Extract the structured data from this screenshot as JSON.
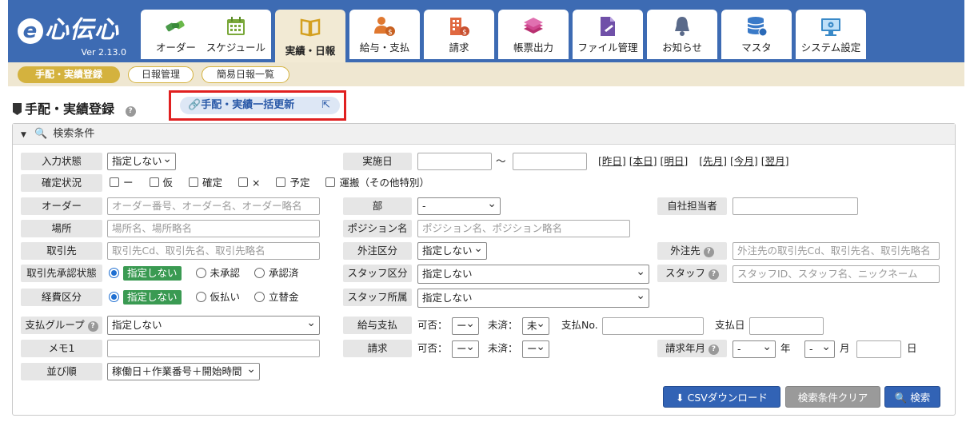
{
  "app": {
    "logo_text": "心伝心",
    "version": "Ver 2.13.0"
  },
  "nav": {
    "tabs": [
      {
        "label": "オーダー",
        "icon": "handshake-icon",
        "color": "#4a9a4a"
      },
      {
        "label": "スケジュール",
        "icon": "calendar-icon",
        "color": "#7aa83a"
      },
      {
        "label": "実績・日報",
        "icon": "book-icon",
        "color": "#d4a020"
      },
      {
        "label": "給与・支払",
        "icon": "person-money-icon",
        "color": "#e07830"
      },
      {
        "label": "請求",
        "icon": "building-money-icon",
        "color": "#e06840"
      },
      {
        "label": "帳票出力",
        "icon": "documents-icon",
        "color": "#d04890"
      },
      {
        "label": "ファイル管理",
        "icon": "file-icon",
        "color": "#7050a8"
      },
      {
        "label": "お知らせ",
        "icon": "bell-icon",
        "color": "#5a6a8a"
      },
      {
        "label": "マスタ",
        "icon": "database-icon",
        "color": "#3a7ac8"
      },
      {
        "label": "システム設定",
        "icon": "monitor-gear-icon",
        "color": "#3a8ac8"
      }
    ]
  },
  "subnav": {
    "items": [
      "手配・実績登録",
      "日報管理",
      "簡易日報一覧"
    ]
  },
  "page": {
    "title": "手配・実績登録",
    "bulk_update_label": "手配・実績一括更新"
  },
  "search": {
    "header": "検索条件",
    "input_status_label": "入力状態",
    "input_status_value": "指定しない",
    "confirm_label": "確定状況",
    "confirm_options": [
      "ー",
      "仮",
      "確定",
      "×",
      "予定",
      "運搬（その他特別）"
    ],
    "order_label": "オーダー",
    "order_placeholder": "オーダー番号、オーダー名、オーダー略名",
    "place_label": "場所",
    "place_placeholder": "場所名、場所略名",
    "client_label": "取引先",
    "client_placeholder": "取引先Cd、取引先名、取引先略名",
    "client_approval_label": "取引先承認状態",
    "client_approval_options": [
      "指定しない",
      "未承認",
      "承認済"
    ],
    "expense_label": "経費区分",
    "expense_options": [
      "指定しない",
      "仮払い",
      "立替金"
    ],
    "pay_group_label": "支払グループ",
    "pay_group_value": "指定しない",
    "memo_label": "メモ1",
    "sort_label": "並び順",
    "sort_value": "稼働日＋作業番号＋開始時間",
    "date_label": "実施日",
    "date_sep": "～",
    "date_links": [
      "[昨日]",
      "[本日]",
      "[明日]",
      "[先月]",
      "[今月]",
      "[翌月]"
    ],
    "dept_label": "部",
    "dept_value": "-",
    "position_label": "ポジション名",
    "position_placeholder": "ポジション名、ポジション略名",
    "outsource_type_label": "外注区分",
    "outsource_type_value": "指定しない",
    "staff_type_label": "スタッフ区分",
    "staff_type_value": "指定しない",
    "staff_dept_label": "スタッフ所属",
    "staff_dept_value": "指定しない",
    "salary_label": "給与支払",
    "salary_possible_label": "可否：",
    "salary_possible_value": "ー",
    "salary_unsettled_label": "未済：",
    "salary_unsettled_value": "未",
    "pay_no_label": "支払No.",
    "pay_date_label": "支払日",
    "billing_label": "請求",
    "billing_possible_label": "可否：",
    "billing_possible_value": "ー",
    "billing_unsettled_label": "未済：",
    "billing_unsettled_value": "ー",
    "manager_label": "自社担当者",
    "outsource_label": "外注先",
    "outsource_placeholder": "外注先の取引先Cd、取引先名、取引先略名",
    "staff_label": "スタッフ",
    "staff_placeholder": "スタッフID、スタッフ名、ニックネーム",
    "billing_month_label": "請求年月",
    "year_value": "-",
    "year_unit": "年",
    "month_value": "-",
    "month_unit": "月",
    "day_unit": "日"
  },
  "buttons": {
    "csv": "CSVダウンロード",
    "clear": "検索条件クリア",
    "search": "検索"
  }
}
